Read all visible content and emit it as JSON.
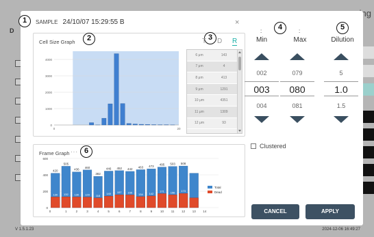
{
  "background": {
    "header_letter": "D",
    "header_right_text": "ing",
    "version": "V 1.5.1.23",
    "datetime": "2024-12-06 16:49:27"
  },
  "modal": {
    "sample_label": "SAMPLE",
    "timestamp": "24/10/07 15:29:55 B",
    "close_label": "×"
  },
  "callouts": [
    "1",
    "2",
    "3",
    "4",
    "5",
    "6"
  ],
  "cell_size": {
    "title": "Cell Size Graph",
    "tabs": [
      {
        "label": "T",
        "active": false
      },
      {
        "label": "D",
        "active": false
      },
      {
        "label": "R",
        "active": true
      }
    ],
    "table": [
      {
        "size": "6 μm",
        "count": "143"
      },
      {
        "size": "7 μm",
        "count": "4"
      },
      {
        "size": "8 μm",
        "count": "413"
      },
      {
        "size": "9 μm",
        "count": "1291"
      },
      {
        "size": "10 μm",
        "count": "4351"
      },
      {
        "size": "11 μm",
        "count": "1309"
      },
      {
        "size": "12 μm",
        "count": "93"
      }
    ]
  },
  "frame": {
    "title": "Frame Graph"
  },
  "stepper": {
    "min": {
      "label": "Min",
      "prev": "002",
      "value": "003",
      "next": "004"
    },
    "max": {
      "label": "Max",
      "prev": "079",
      "value": "080",
      "next": "081"
    },
    "dilution": {
      "label": "Dilution",
      "prev": "5",
      "value": "1.0",
      "next": "1.5"
    },
    "dots_left": ": ",
    "dots_right": ":"
  },
  "clustered_label": "Clustered",
  "buttons": {
    "cancel": "CANCEL",
    "apply": "APPLY"
  },
  "colors": {
    "accent": "#1ab0a8",
    "button": "#3d5163",
    "total": "#3f86cc",
    "dead": "#e04a2a",
    "hist_bg": "#c8dcf4",
    "hist_bar": "#3f7fd0"
  },
  "chart_data": [
    {
      "type": "bar",
      "title": "Cell Size Graph",
      "x": [
        6,
        7,
        8,
        9,
        10,
        11,
        12,
        13,
        14,
        15,
        16,
        17,
        18,
        19
      ],
      "values": [
        143,
        4,
        413,
        1291,
        4351,
        1309,
        93,
        60,
        40,
        30,
        20,
        10,
        8,
        5
      ],
      "xlim": [
        0,
        20
      ],
      "ylim": [
        0,
        4500
      ],
      "yticks": [
        0,
        1000,
        2000,
        3000,
        4000
      ],
      "xticks": [
        0,
        20
      ],
      "highlight_range": [
        3,
        20
      ]
    },
    {
      "type": "bar",
      "title": "Frame Graph",
      "categories": [
        "1",
        "2",
        "3",
        "4",
        "5",
        "6",
        "7",
        "8",
        "9",
        "10",
        "11",
        "12",
        "13",
        "14"
      ],
      "series": [
        {
          "name": "Total",
          "values": [
            420,
            505,
            436,
            460,
            382,
            446,
            452,
            442,
            463,
            473,
            495,
            503,
            508,
            420
          ]
        },
        {
          "name": "Dead",
          "values": [
            130,
            132,
            130,
            129,
            118,
            140,
            157,
            155,
            134,
            142,
            171,
            156,
            173,
            120
          ]
        }
      ],
      "data_labels_total": [
        "420",
        "505",
        "436",
        "460",
        "382",
        "446",
        "452",
        "442",
        "463",
        "473",
        "495",
        "503",
        "508",
        ""
      ],
      "data_labels_dead": [
        "130",
        "132",
        "130",
        "129",
        "118",
        "140",
        "157",
        "155",
        "134",
        "142",
        "171",
        "156",
        "173",
        ""
      ],
      "x_axis_labels": [
        "0",
        "1",
        "2",
        "3",
        "4",
        "5",
        "6",
        "7",
        "8",
        "9",
        "10",
        "11",
        "12",
        "13",
        "14"
      ],
      "ylim": [
        0,
        600
      ],
      "yticks": [
        0,
        200,
        400,
        600
      ],
      "legend_position": "right"
    }
  ]
}
